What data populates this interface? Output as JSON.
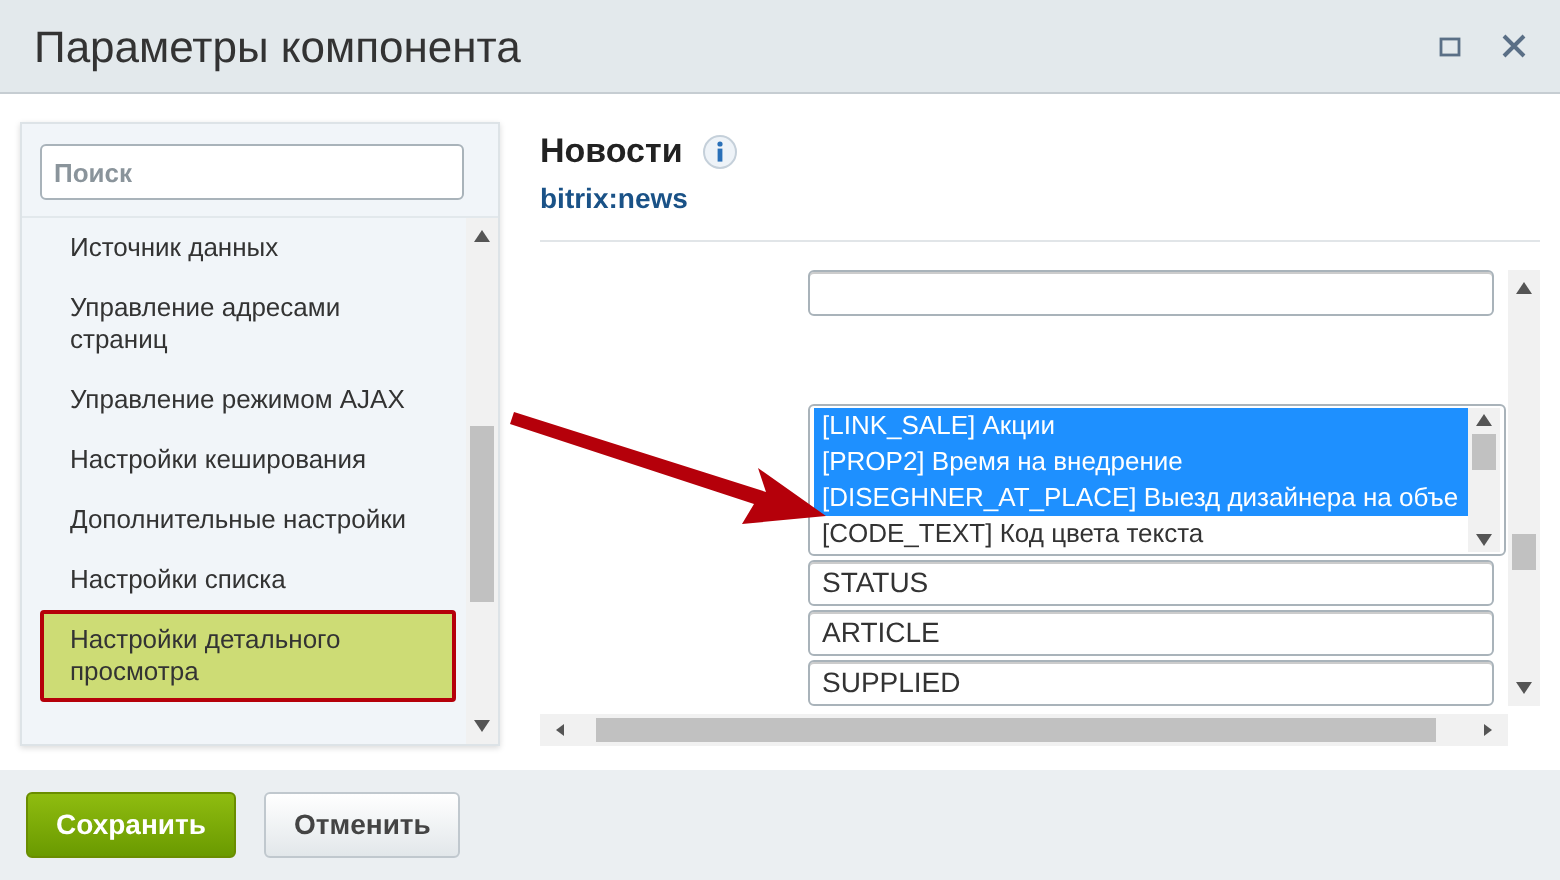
{
  "window": {
    "title": "Параметры компонента"
  },
  "sidebar": {
    "search": {
      "placeholder": "Поиск"
    },
    "items": [
      {
        "label": "Источник данных",
        "selected": false
      },
      {
        "label": "Управление адресами страниц",
        "selected": false
      },
      {
        "label": "Управление режимом AJAX",
        "selected": false
      },
      {
        "label": "Настройки кеширования",
        "selected": false
      },
      {
        "label": "Дополнительные настройки",
        "selected": false
      },
      {
        "label": "Настройки списка",
        "selected": false
      },
      {
        "label": "Настройки детального просмотра",
        "selected": true
      }
    ]
  },
  "component": {
    "title": "Новости",
    "code": "bitrix:news"
  },
  "fields": [
    {
      "kind": "input"
    },
    {
      "kind": "multiselect",
      "options": [
        {
          "label": "[LINK_SALE] Акции",
          "selected": true
        },
        {
          "label": "[PROP2] Время на внедрение",
          "selected": true
        },
        {
          "label": "[DISEGHNER_AT_PLACE] Выезд дизайнера на объе",
          "selected": true
        },
        {
          "label": "[CODE_TEXT] Код цвета текста",
          "selected": false
        }
      ]
    },
    {
      "kind": "input",
      "value": "STATUS"
    },
    {
      "kind": "input",
      "value": "ARTICLE"
    },
    {
      "kind": "input",
      "value": "SUPPLIED"
    }
  ],
  "buttons": [
    {
      "label": "Сохранить",
      "kind": "primary"
    },
    {
      "label": "Отменить",
      "kind": "secondary"
    }
  ]
}
